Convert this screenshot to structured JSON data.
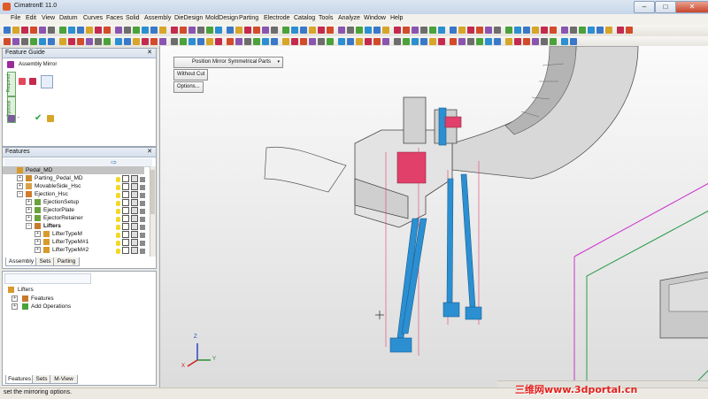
{
  "window": {
    "title": "CimatronE 11.0",
    "min": "–",
    "max": "□",
    "close": "✕"
  },
  "menu": [
    "File",
    "Edit",
    "View",
    "Datum",
    "Curves",
    "Faces",
    "Solid",
    "Assembly",
    "DieDesign",
    "MoldDesign",
    "Parting",
    "Electrode",
    "Catalog",
    "Tools",
    "Analyze",
    "Window",
    "Help"
  ],
  "feature_guide": {
    "title": "Feature Guide",
    "close": "✕",
    "command": "Assembly Mirror",
    "side_required": "Required",
    "side_optional": "Optional"
  },
  "features_panel": {
    "title": "Features",
    "close": "✕",
    "rows": [
      {
        "name": "Pedal_MD",
        "indent": 0,
        "selected": true
      },
      {
        "name": "Parting_Pedal_MD",
        "indent": 1
      },
      {
        "name": "MovableSide_Hsc",
        "indent": 1
      },
      {
        "name": "Ejection_Hsc",
        "indent": 1
      },
      {
        "name": "EjectionSetup",
        "indent": 2
      },
      {
        "name": "EjectorPlate",
        "indent": 2
      },
      {
        "name": "EjectorRetainer",
        "indent": 2
      },
      {
        "name": "Lifters",
        "indent": 2,
        "bold": true
      },
      {
        "name": "LifterTypeM",
        "indent": 3
      },
      {
        "name": "LifterTypeM#1",
        "indent": 3
      },
      {
        "name": "LifterTypeM#2",
        "indent": 3
      }
    ],
    "tabs": [
      "Assembly",
      "Sets",
      "Parting"
    ]
  },
  "lower_panel": {
    "root": "Lifters",
    "children": [
      "Features",
      "Add Operations"
    ],
    "tabs": [
      "Features",
      "Sets",
      "M-View"
    ]
  },
  "viewport": {
    "dropdown": "Position Mirror Symmetrical Parts",
    "without_cut": "Without Cut",
    "options": "Options...",
    "axis_z": "Z",
    "axis_y": "Y",
    "axis_x": "X"
  },
  "status": {
    "message": "set the mirroring options."
  },
  "watermark": "三维网www.3dportal.cn",
  "colors": {
    "accent_blue": "#2b8fd1",
    "magenta": "#cc3399",
    "pink_part": "#e0406a"
  }
}
